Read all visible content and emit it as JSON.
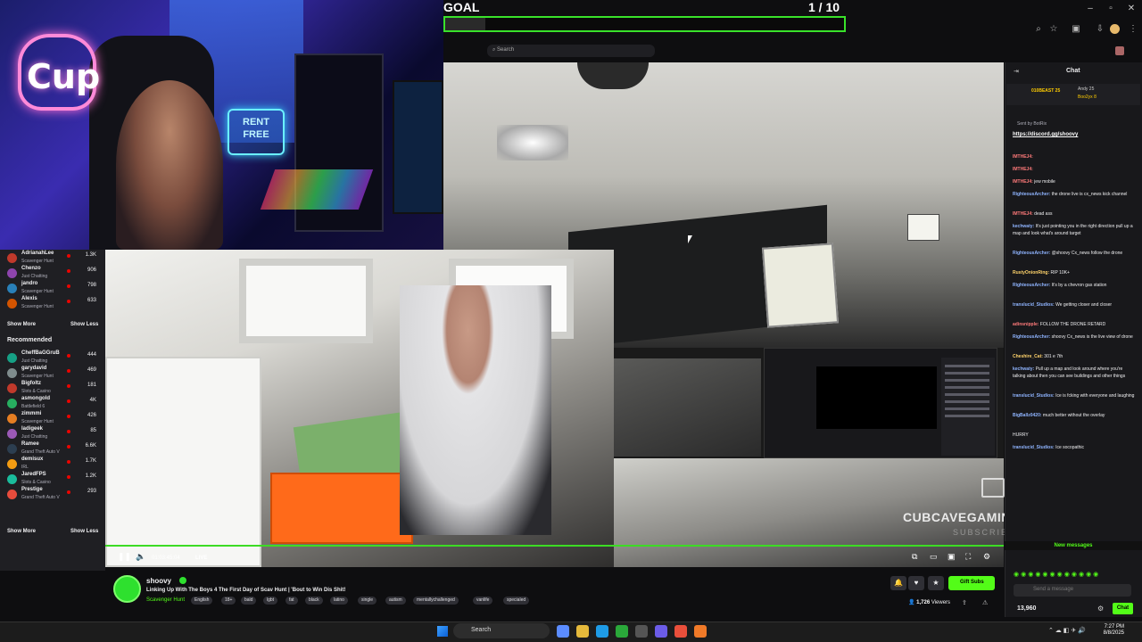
{
  "goal": {
    "label": "GOAL",
    "count": "1  / 10",
    "progress_fraction": 0.1
  },
  "webcam": {
    "sign_text": "RENT FREE",
    "logo_text": "Cup"
  },
  "browser": {
    "search_placeholder": "Search"
  },
  "sidebar": {
    "channels": [
      {
        "name": "AdrianahLee",
        "game": "Scavenger Hunt",
        "viewers": "1.3K",
        "color": "#c0392b"
      },
      {
        "name": "Chenzo",
        "game": "Just Chatting",
        "viewers": "906",
        "color": "#8e44ad"
      },
      {
        "name": "jandro",
        "game": "Scavenger Hunt",
        "viewers": "798",
        "color": "#2980b9"
      },
      {
        "name": "Alexis",
        "game": "Scavenger Hunt",
        "viewers": "633",
        "color": "#d35400"
      }
    ],
    "show_more": "Show More",
    "show_less": "Show Less",
    "recommended_heading": "Recommended",
    "recommended": [
      {
        "name": "CheffBaGGruB",
        "game": "Just Chatting",
        "viewers": "444",
        "color": "#16a085"
      },
      {
        "name": "garydavid",
        "game": "Scavenger Hunt",
        "viewers": "469",
        "color": "#7f8c8d"
      },
      {
        "name": "Bigfoltz",
        "game": "Slots & Casino",
        "viewers": "181",
        "color": "#c0392b"
      },
      {
        "name": "asmongold",
        "game": "Battlefield 6",
        "viewers": "4K",
        "color": "#27ae60"
      },
      {
        "name": "zimmmi",
        "game": "Scavenger Hunt",
        "viewers": "426",
        "color": "#e67e22"
      },
      {
        "name": "ladigeek",
        "game": "Just Chatting",
        "viewers": "85",
        "color": "#9b59b6"
      },
      {
        "name": "Ramee",
        "game": "Grand Theft Auto V",
        "viewers": "6.6K",
        "color": "#2c3e50"
      },
      {
        "name": "demisux",
        "game": "IRL",
        "viewers": "1.7K",
        "color": "#f39c12"
      },
      {
        "name": "JaredFPS",
        "game": "Slots & Casino",
        "viewers": "1.2K",
        "color": "#1abc9c"
      },
      {
        "name": "Prestige",
        "game": "Grand Theft Auto V",
        "viewers": "293",
        "color": "#e74c3c"
      }
    ]
  },
  "player": {
    "time": "01:03:45:04",
    "live": "LIVE"
  },
  "watermark": {
    "main": "CUBCAVEGAMING",
    "sub": "SUBSCRIBE"
  },
  "channel": {
    "name": "shoovy",
    "title": "Linking Up With The Boys 4 The First Day of Scav Hunt | 'Bout to Win Dis Shit!",
    "category": "Scavenger Hunt",
    "tags": [
      "English",
      "18+",
      "bald",
      "lgbt",
      "fat",
      "black",
      "latino",
      "single",
      "autism",
      "mentallychallenged",
      "vanlife",
      "specialed"
    ],
    "gift_label": "Gift Subs",
    "viewers_count": "1,726",
    "viewers_label": "Viewers"
  },
  "chat": {
    "title": "Chat",
    "leaderboard": [
      "010BEAST 25",
      "Andy 25",
      "Boo2yx 8"
    ],
    "pinned_by": "Sent by BotRix",
    "pinned_link": "https://discord.gg/shoovy",
    "messages": [
      {
        "user": "IMTHEJ4:",
        "text": "",
        "color": "#ff7a7a"
      },
      {
        "user": "IMTHEJ4:",
        "text": "",
        "color": "#ff7a7a"
      },
      {
        "user": "IMTHEJ4:",
        "text": "jew mobile",
        "color": "#ff7a7a"
      },
      {
        "user": "RighteousArcher:",
        "text": "the drone live is cx_news kick channel",
        "color": "#8fb4ff"
      },
      {
        "user": "IMTHEJ4:",
        "text": "dead ass",
        "color": "#ff7a7a"
      },
      {
        "user": "kechwaty:",
        "text": "It's just pointing you in the right direction pull up a map and look what's around target",
        "color": "#8fb4ff"
      },
      {
        "user": "RighteousArcher:",
        "text": "@shoovy Cx_news follow the drone",
        "color": "#8fb4ff"
      },
      {
        "user": "RustyOnionRing:",
        "text": "RIP 10K+",
        "color": "#ffd36b"
      },
      {
        "user": "RighteousArcher:",
        "text": "It's by a chevron gas station",
        "color": "#8fb4ff"
      },
      {
        "user": "translucid_Studios:",
        "text": "We getting closer and closer",
        "color": "#8fb4ff"
      },
      {
        "user": "adinsnipple:",
        "text": "FOLLOW THE DRONE RETARD",
        "color": "#ff7a7a"
      },
      {
        "user": "RighteousArcher:",
        "text": "shoovy Cx_news is the live view of drone",
        "color": "#8fb4ff"
      },
      {
        "user": "Cheshire_Cat:",
        "text": "301 e 7th",
        "color": "#ffd36b"
      },
      {
        "user": "kechwaty:",
        "text": "Pull up a map and look around where you're talking about then you can see buildings and other things",
        "color": "#8fb4ff"
      },
      {
        "user": "translucid_Studios:",
        "text": "Ice is fcking with everyone and laughing",
        "color": "#8fb4ff"
      },
      {
        "user": "BigBallz0420:",
        "text": "much better without the overlay",
        "color": "#8fb4ff"
      },
      {
        "user": "",
        "text": "HURRY",
        "color": "#8fb4ff"
      },
      {
        "user": "translucid_Studios:",
        "text": "Ice socopathic",
        "color": "#8fb4ff"
      }
    ],
    "new_messages": "New messages",
    "input_placeholder": "Send a message",
    "points": "13,960",
    "send_label": "Chat"
  },
  "taskbar": {
    "search": "Search",
    "time": "7:27 PM",
    "date": "8/8/2025"
  }
}
